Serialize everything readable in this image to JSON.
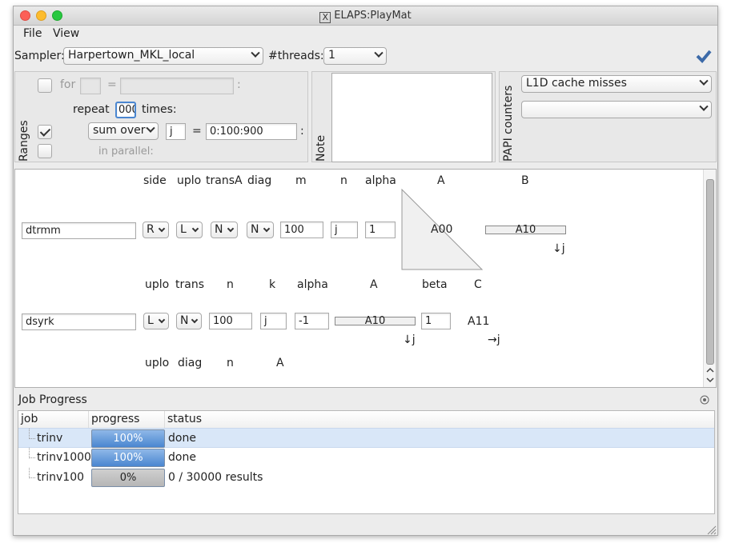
{
  "window": {
    "title": "ELAPS:PlayMat"
  },
  "menu": {
    "file": "File",
    "view": "View"
  },
  "toolbar": {
    "sampler_label": "Sampler:",
    "sampler_value": "Harpertown_MKL_local",
    "threads_label": "#threads:",
    "threads_value": "1"
  },
  "ranges": {
    "title": "Ranges",
    "for_label": "for",
    "eq": "=",
    "colon": ":",
    "repeat_label": "repeat",
    "repeat_value": "000",
    "times_label": "times:",
    "sumover_value": "sum over",
    "sum_var": "j",
    "sum_range": "0:100:900",
    "parallel_label": "in parallel:"
  },
  "note": {
    "title": "Note",
    "value": ""
  },
  "papi": {
    "title": "PAPI counters",
    "counter1": "L1D cache misses",
    "counter2": ""
  },
  "calls": {
    "dtrmm": {
      "name": "dtrmm",
      "headers": [
        "side",
        "uplo",
        "transA",
        "diag",
        "m",
        "n",
        "alpha",
        "A",
        "B"
      ],
      "side": "R",
      "uplo": "L",
      "transA": "N",
      "diag": "N",
      "m": "100",
      "n": "j",
      "alpha": "1",
      "A": "A00",
      "B": "A10",
      "B_dim": "↓j"
    },
    "dsyrk": {
      "name": "dsyrk",
      "headers": [
        "uplo",
        "trans",
        "n",
        "k",
        "alpha",
        "A",
        "beta",
        "C"
      ],
      "uplo": "L",
      "trans": "N",
      "n": "100",
      "k": "j",
      "alpha": "-1",
      "A": "A10",
      "A_dim": "↓j",
      "beta": "1",
      "C": "A11",
      "C_dim": "→j"
    },
    "third_headers": [
      "uplo",
      "diag",
      "n",
      "A"
    ]
  },
  "jobs": {
    "title": "Job Progress",
    "columns": [
      "job",
      "progress",
      "status"
    ],
    "rows": [
      {
        "job": "trinv",
        "progress": "100%",
        "progress_value": 1.0,
        "status": "done"
      },
      {
        "job": "trinv1000",
        "progress": "100%",
        "progress_value": 1.0,
        "status": "done"
      },
      {
        "job": "trinv100",
        "progress": "0%",
        "progress_value": 0.0,
        "status": "0 / 30000 results"
      }
    ]
  },
  "colors": {
    "accent": "#4a86d0",
    "selection": "#d9e7f8"
  }
}
